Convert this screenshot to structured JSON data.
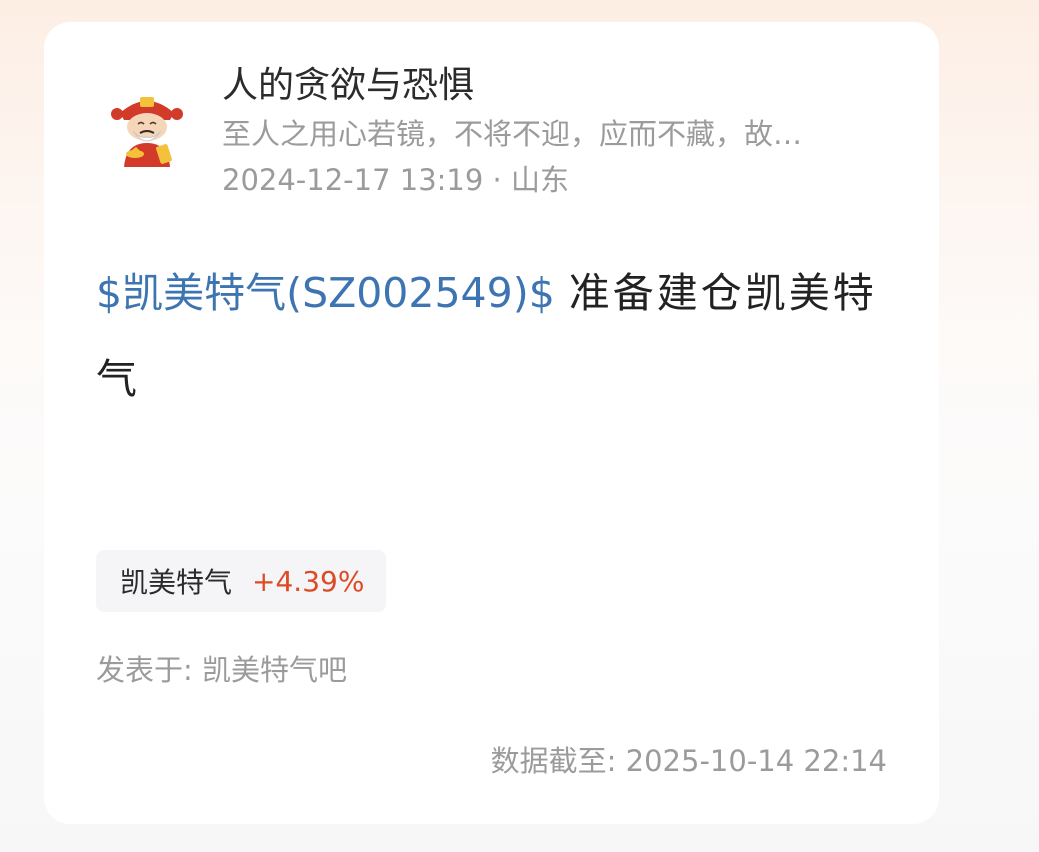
{
  "author": {
    "name": "人的贪欲与恐惧",
    "bio": "至人之用心若镜，不将不迎，应而不藏，故…",
    "avatar_icon": "fortune-god-avatar-icon"
  },
  "post": {
    "datetime": "2024-12-17 13:19",
    "separator": "·",
    "location": "山东",
    "stock_link": "$凯美特气(SZ002549)$",
    "text": "准备建仓凯美特气"
  },
  "stock_chip": {
    "name": "凯美特气",
    "change": "+4.39%"
  },
  "posted_in": "发表于: 凯美特气吧",
  "data_time": "数据截至: 2025-10-14 22:14",
  "colors": {
    "link": "#3d74b2",
    "rise": "#dd4b25",
    "muted": "#9b9b9b"
  }
}
